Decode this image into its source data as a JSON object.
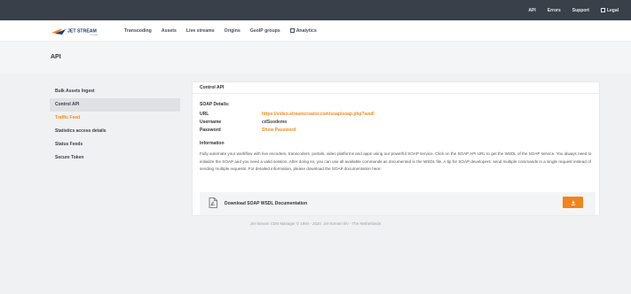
{
  "topbar": {
    "links": [
      "API",
      "Errors",
      "Support",
      "Legal"
    ]
  },
  "brand": {
    "logo_text": "JET STREAM",
    "logo_sub": "STREAM",
    "color": "#1f3a6b"
  },
  "nav": {
    "items": [
      "Transcoding",
      "Assets",
      "Live streams",
      "Origins",
      "GeoIP groups",
      "Analytics"
    ]
  },
  "page": {
    "title": "API"
  },
  "sidebar": {
    "items": [
      {
        "label": "Bulk Assets Ingest",
        "state": "default"
      },
      {
        "label": "Control API",
        "state": "active"
      },
      {
        "label": "Traffic Feed",
        "state": "highlight"
      },
      {
        "label": "Statistics access details",
        "state": "default"
      },
      {
        "label": "Status Feeds",
        "state": "default"
      },
      {
        "label": "Secure Token",
        "state": "default"
      }
    ]
  },
  "panel": {
    "title": "Control API",
    "soap": {
      "heading": "SOAP Details:",
      "url_label": "URL",
      "url_value": "https://video.streamcreator.com/soap/soap.php?wsdl",
      "username_label": "Username",
      "username_value": "cdSsodemo",
      "password_label": "Password",
      "password_value": "Show Password"
    },
    "info": {
      "heading": "Information",
      "text": "Fully automate your workflow with live encoders, transcoders, portals, video platforms and apps using our powerful SOAP service. Click on the SOAP API URL to get the WSDL of the SOAP service. You always need to initialize the SOAP and you need a valid session. After doing so, you can use all available commands as documented in the WSDL file. A tip for SOAP developers: send multiple commands in a single request instead of sending multiple requests. For detailed information, please download the SOAP documentation here:"
    },
    "download": {
      "label": "Download SOAP WSDL Documentation",
      "icon": "pdf-file-icon",
      "button_icon": "download-icon"
    }
  },
  "footer": {
    "text": "Jet-Stream CDN Manager © 1994 - 2020. Jet-Stream BV - The Netherlands"
  },
  "colors": {
    "accent": "#f0851b",
    "topbar": "#3a4049",
    "background": "#f0f1f2"
  }
}
